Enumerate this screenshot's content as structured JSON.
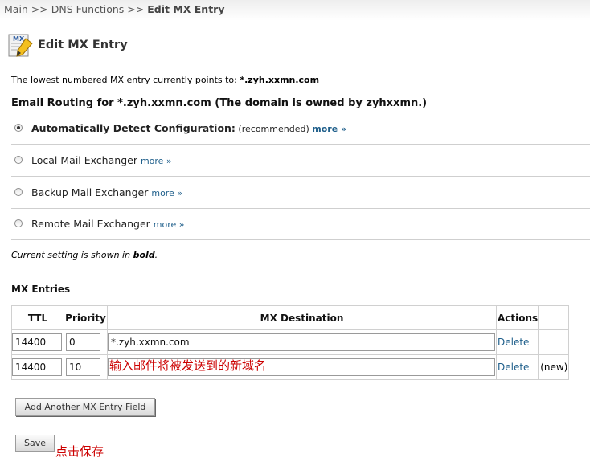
{
  "breadcrumb": {
    "main": "Main",
    "sep1": " >> ",
    "dns": "DNS Functions",
    "sep2": " >> ",
    "current": "Edit MX Entry"
  },
  "title_icon_label": "MX",
  "page_title": "Edit MX Entry",
  "lowest_entry": {
    "text": "The lowest numbered MX entry currently points to: ",
    "value": "*.zyh.xxmn.com"
  },
  "routing_heading": "Email Routing for *.zyh.xxmn.com (The domain is owned by zyhxxmn.)",
  "routing_options": [
    {
      "label": "Automatically Detect Configuration:",
      "suffix": " (recommended) ",
      "more": "more »",
      "selected": true
    },
    {
      "label": "Local Mail Exchanger",
      "more": "more »",
      "selected": false
    },
    {
      "label": "Backup Mail Exchanger",
      "more": "more »",
      "selected": false
    },
    {
      "label": "Remote Mail Exchanger",
      "more": "more »",
      "selected": false
    }
  ],
  "current_note": {
    "prefix": "Current setting is shown in ",
    "bold": "bold",
    "suffix": "."
  },
  "mx_heading": "MX Entries",
  "mx_table": {
    "headers": [
      "TTL",
      "Priority",
      "MX Destination",
      "Actions"
    ],
    "rows": [
      {
        "ttl": "14400",
        "priority": "0",
        "destination": "*.zyh.xxmn.com",
        "action": "Delete",
        "tag": ""
      },
      {
        "ttl": "14400",
        "priority": "10",
        "destination": "",
        "action": "Delete",
        "tag": "(new)"
      }
    ]
  },
  "annotations": {
    "destination_hint": "输入邮件将被发送到的新域名",
    "save_hint": "点击保存"
  },
  "buttons": {
    "add_field": "Add Another MX Entry Field",
    "save": "Save"
  },
  "colors": {
    "link": "#1f5f8b",
    "annotation": "#cc0000",
    "divider": "#cfcfcf"
  }
}
